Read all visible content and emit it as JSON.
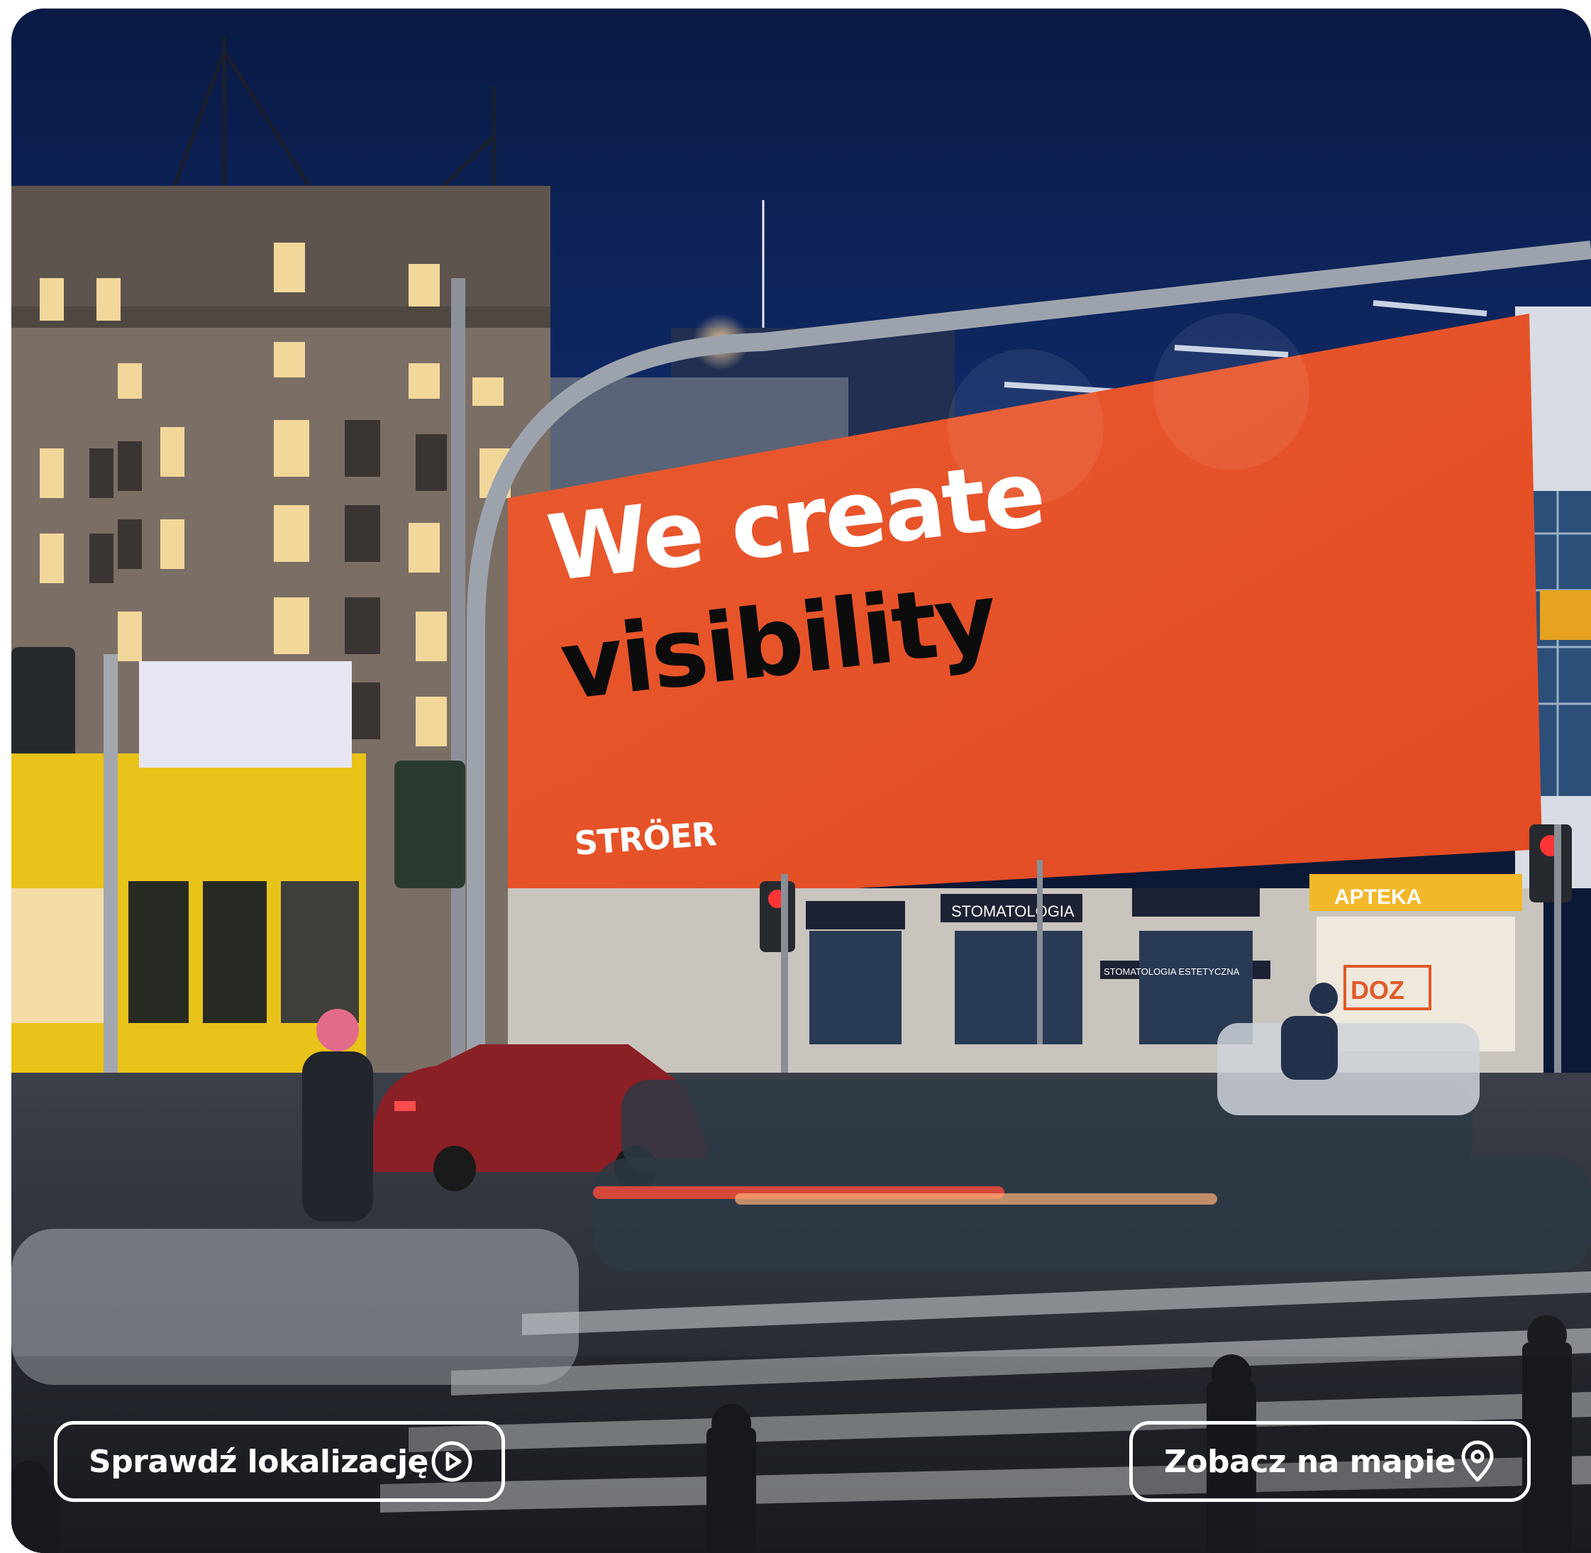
{
  "billboard": {
    "headline_line1": "We create",
    "headline_line2": "visibility",
    "brand_logo": "STRÖER",
    "background_color": "#e8512a"
  },
  "storefront_signs": {
    "pharmacy": "APTEKA",
    "dentist": "STOMATOLOGIA",
    "dentist_aesthetic": "STOMATOLOGIA ESTETYCZNA",
    "pharmacy_brand": "DOZ"
  },
  "actions": {
    "check_location_label": "Sprawdź lokalizację",
    "check_location_icon": "play-circle-icon",
    "view_on_map_label": "Zobacz na mapie",
    "view_on_map_icon": "map-pin-icon"
  }
}
